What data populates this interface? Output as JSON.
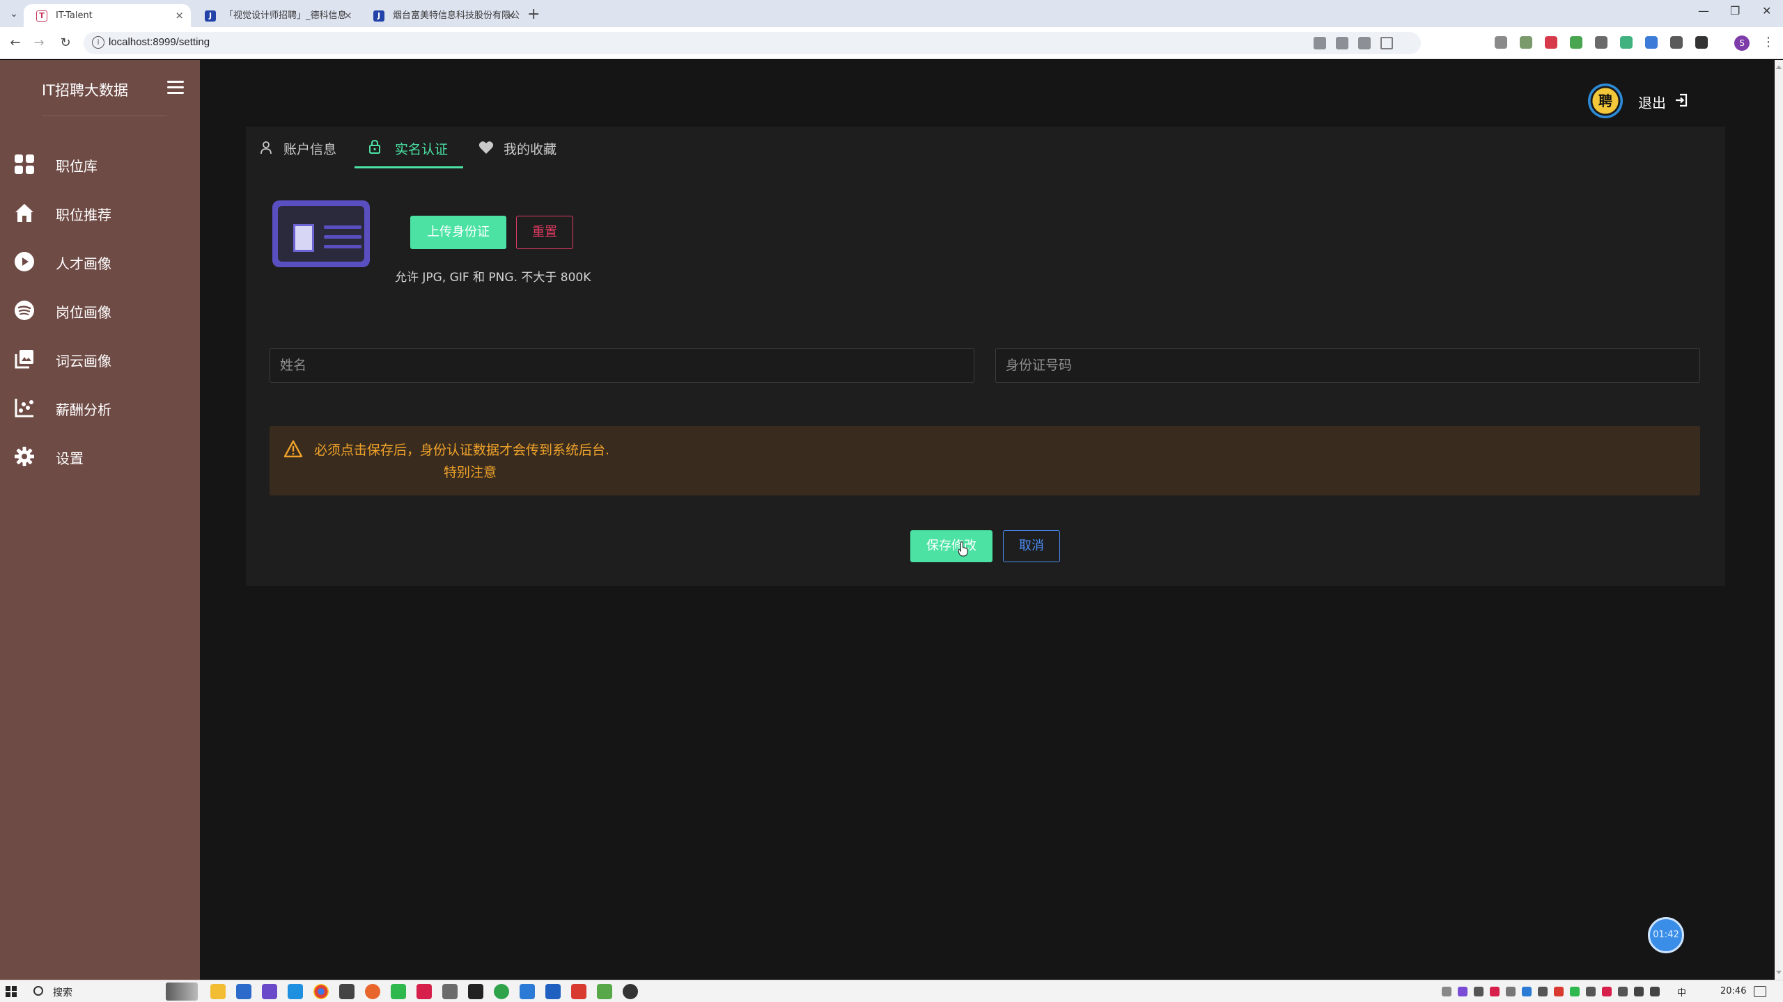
{
  "browser": {
    "tabs": [
      {
        "title": "IT-Talent",
        "active": true
      },
      {
        "title": "「视觉设计师招聘」_德科信息",
        "active": false
      },
      {
        "title": "烟台富美特信息科技股份有限公",
        "active": false
      }
    ],
    "url": "localhost:8999/setting"
  },
  "sidebar": {
    "brand": "IT招聘大数据",
    "items": [
      {
        "label": "职位库",
        "icon": "grid-icon"
      },
      {
        "label": "职位推荐",
        "icon": "home-icon"
      },
      {
        "label": "人才画像",
        "icon": "play-circle-icon"
      },
      {
        "label": "岗位画像",
        "icon": "spotify-icon"
      },
      {
        "label": "词云画像",
        "icon": "image-stack-icon"
      },
      {
        "label": "薪酬分析",
        "icon": "bar-chart-icon"
      },
      {
        "label": "设置",
        "icon": "gear-icon"
      }
    ]
  },
  "header": {
    "avatar_text": "聘",
    "logout_label": "退出"
  },
  "settings": {
    "tabs": [
      {
        "label": "账户信息",
        "icon": "user-icon",
        "active": false
      },
      {
        "label": "实名认证",
        "icon": "lock-icon",
        "active": true
      },
      {
        "label": "我的收藏",
        "icon": "heart-icon",
        "active": false
      }
    ],
    "upload_label": "上传身份证",
    "reset_label": "重置",
    "hint": "允许 JPG, GIF 和 PNG. 不大于 800K",
    "name_placeholder": "姓名",
    "id_placeholder": "身份证号码",
    "alert_line1": "必须点击保存后，身份认证数据才会传到系统后台.",
    "alert_line2": "特别注意",
    "save_label": "保存修改",
    "cancel_label": "取消"
  },
  "timer": "01:42",
  "taskbar": {
    "search_label": "搜索",
    "ime": "中",
    "time": "20:46"
  },
  "colors": {
    "sidebar_bg": "#6f4b46",
    "accent_green": "#4be2a4",
    "danger": "#e33b63",
    "warning_text": "#f0a22a",
    "cancel_blue": "#4a8df5"
  }
}
